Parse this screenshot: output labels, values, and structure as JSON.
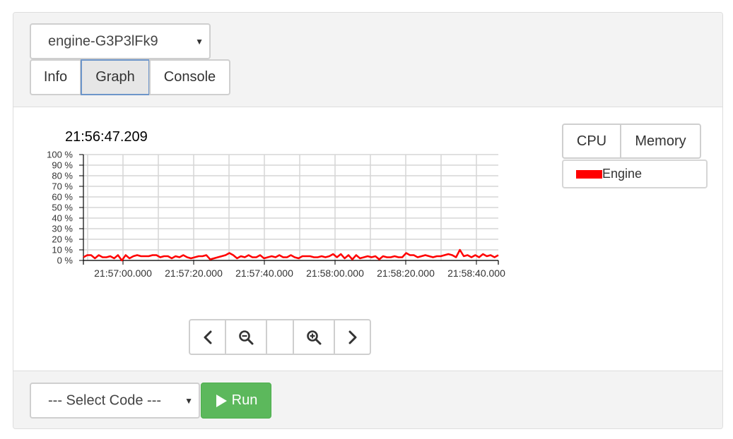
{
  "engine_select": {
    "value": "engine-G3P3lFk9"
  },
  "tabs": [
    {
      "label": "Info",
      "active": false
    },
    {
      "label": "Graph",
      "active": true
    },
    {
      "label": "Console",
      "active": false
    }
  ],
  "graph": {
    "timestamp": "21:56:47.209",
    "metric_buttons": [
      {
        "label": "CPU"
      },
      {
        "label": "Memory"
      }
    ],
    "legend": {
      "label": "Engine",
      "color": "#ff0000"
    },
    "nav_icons": [
      "chevron-left-icon",
      "zoom-out-icon",
      "blank",
      "zoom-in-icon",
      "chevron-right-icon"
    ]
  },
  "footer": {
    "code_select": {
      "value": "--- Select Code ---"
    },
    "run_label": "Run",
    "run_color": "#5cb85c"
  },
  "chart_data": {
    "type": "line",
    "series": [
      {
        "name": "Engine",
        "color": "#ff0000",
        "values": [
          3,
          5,
          5,
          2,
          5,
          3,
          3,
          4,
          2,
          5,
          0,
          5,
          2,
          4,
          5,
          4,
          4,
          4,
          5,
          5,
          3,
          4,
          4,
          2,
          4,
          3,
          5,
          3,
          2,
          3,
          4,
          4,
          5,
          1,
          2,
          3,
          4,
          5,
          7,
          5,
          2,
          4,
          3,
          5,
          3,
          3,
          5,
          2,
          3,
          4,
          3,
          5,
          3,
          3,
          5,
          3,
          2,
          4,
          4,
          4,
          3,
          3,
          4,
          3,
          4,
          6,
          3,
          6,
          2,
          5,
          1,
          5,
          2,
          3,
          4,
          3,
          4,
          1,
          4,
          3,
          3,
          4,
          3,
          3,
          7,
          5,
          5,
          3,
          4,
          5,
          4,
          3,
          4,
          4,
          5,
          6,
          5,
          3,
          10,
          4,
          5,
          3,
          5,
          3,
          6,
          4,
          5,
          3,
          5
        ]
      }
    ],
    "x_tick_labels": [
      "21:57:00.000",
      "21:57:20.000",
      "21:57:40.000",
      "21:58:00.000",
      "21:58:20.000",
      "21:58:40.000"
    ],
    "y_tick_labels": [
      "0 %",
      "10 %",
      "20 %",
      "30 %",
      "40 %",
      "50 %",
      "60 %",
      "70 %",
      "80 %",
      "90 %",
      "100 %"
    ],
    "ylim": [
      0,
      100
    ],
    "grid": true,
    "legend_position": "top-right"
  }
}
